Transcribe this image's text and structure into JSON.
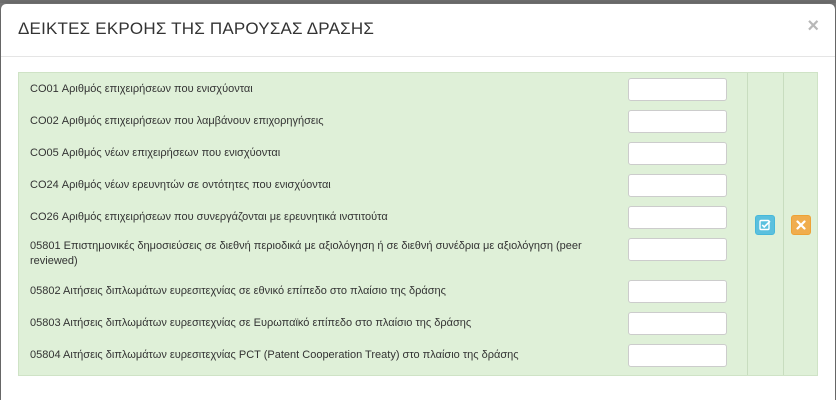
{
  "modal": {
    "title": "ΔΕΙΚΤΕΣ ΕΚΡΟΗΣ ΤΗΣ ΠΑΡΟΥΣΑΣ ΔΡΑΣΗΣ",
    "close_symbol": "×"
  },
  "indicators": [
    {
      "code": "CO01",
      "label": "CO01  Αριθμός επιχειρήσεων που ενισχύονται",
      "value": ""
    },
    {
      "code": "CO02",
      "label": "CO02  Αριθμός επιχειρήσεων που λαμβάνουν επιχορηγήσεις",
      "value": ""
    },
    {
      "code": "CO05",
      "label": "CO05  Αριθμός νέων επιχειρήσεων που ενισχύονται",
      "value": ""
    },
    {
      "code": "CO24",
      "label": "CO24 Αριθμός νέων ερευνητών σε οντότητες που ενισχύονται",
      "value": ""
    },
    {
      "code": "CO26",
      "label": "CO26  Αριθμός επιχειρήσεων που συνεργάζονται με ερευνητικά ινστιτούτα",
      "value": ""
    },
    {
      "code": "05801",
      "label": "05801  Επιστημονικές δημοσιεύσεις σε διεθνή περιοδικά με αξιολόγηση ή σε διεθνή συνέδρια με αξιολόγηση (peer reviewed)",
      "value": ""
    },
    {
      "code": "05802",
      "label": "05802  Αιτήσεις διπλωμάτων ευρεσιτεχνίας σε εθνικό επίπεδο στο πλαίσιο της δράσης",
      "value": ""
    },
    {
      "code": "05803",
      "label": "05803  Αιτήσεις διπλωμάτων ευρεσιτεχνίας σε Ευρωπαϊκό επίπεδο στο πλαίσιο της δράσης",
      "value": ""
    },
    {
      "code": "05804",
      "label": "05804  Αιτήσεις διπλωμάτων ευρεσιτεχνίας PCT (Patent Cooperation Treaty) στο πλαίσιο της δράσης",
      "value": ""
    }
  ],
  "actions": {
    "edit_icon": "check-square-icon",
    "delete_icon": "x-icon",
    "edit_color": "#5bc0de",
    "delete_color": "#f0ad4e"
  },
  "colors": {
    "row_background": "#dff0d8",
    "title_text": "#333333"
  }
}
